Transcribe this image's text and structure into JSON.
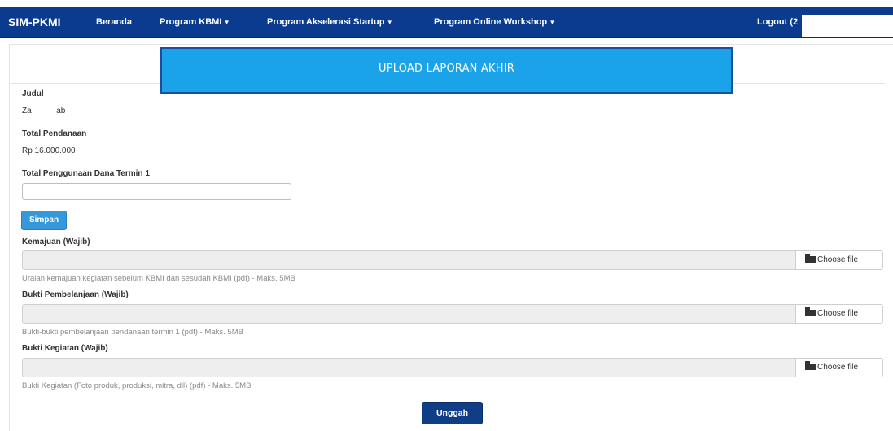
{
  "navbar": {
    "brand": "SIM-PKMI",
    "items": [
      {
        "label": "Beranda",
        "caret": ""
      },
      {
        "label": "Program KBMI",
        "caret": "▾"
      },
      {
        "label": "Program Akselerasi Startup",
        "caret": "▾"
      },
      {
        "label": "Program Online Workshop",
        "caret": "▾"
      }
    ],
    "logout": "Logout (2"
  },
  "banner": {
    "title": "UPLOAD LAPORAN AKHIR"
  },
  "form": {
    "judul_label": "Judul",
    "judul_value": "Za           ab",
    "pendanaan_label": "Total Pendanaan",
    "pendanaan_value": "Rp 16.000.000",
    "penggunaan_label": "Total Penggunaan Dana Termin 1",
    "penggunaan_value": "",
    "simpan_label": "Simpan",
    "files": [
      {
        "label": "Kemajuan (Wajib)",
        "button": "Choose file",
        "help": "Uraian kemajuan kegiatan sebelum KBMI dan sesudah KBMI (pdf) - Maks. 5MB"
      },
      {
        "label": "Bukti Pembelanjaan (Wajib)",
        "button": "Choose file",
        "help": "Bukti-bukti pembelanjaan pendanaan termin 1 (pdf) - Maks. 5MB"
      },
      {
        "label": "Bukti Kegiatan (Wajib)",
        "button": "Choose file",
        "help": "Bukti Kegiatan (Foto produk, produksi, mitra, dll) (pdf) - Maks. 5MB"
      }
    ],
    "submit_label": "Unggah"
  },
  "colors": {
    "navbar": "#0a3b8f",
    "banner": "#1aa3e8",
    "simpan_button": "#3498db",
    "unggah_button": "#0f3d86"
  },
  "icons": [
    "folder-open-icon",
    "caret-down-icon"
  ]
}
